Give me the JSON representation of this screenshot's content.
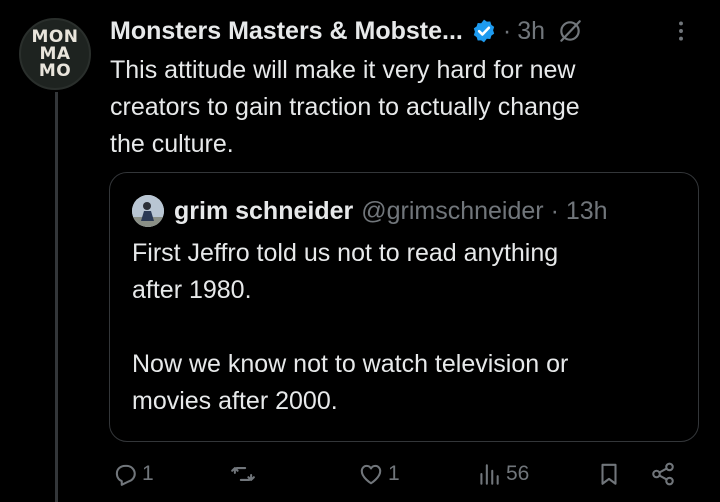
{
  "post": {
    "avatar_lines": [
      "MON",
      "MA",
      "MO"
    ],
    "author_name": "Monsters Masters & Mobste...",
    "separator": "·",
    "time": "3h",
    "text_lines": [
      "This attitude will make it very hard for new",
      "creators to gain traction to actually change",
      "the culture."
    ]
  },
  "quote": {
    "name": "grim schneider",
    "handle_time": "@grimschneider · 13h",
    "paragraphs": [
      [
        "First Jeffro told us not to read anything",
        "after 1980."
      ],
      [
        "Now we know not to watch television or",
        "movies after 2000."
      ]
    ]
  },
  "actions": {
    "reply_count": "1",
    "retweet_count": "",
    "like_count": "1",
    "views_count": "56"
  },
  "colors": {
    "background": "#000000",
    "text": "#e7e9ea",
    "muted": "#71767b",
    "verified": "#1d9bf0",
    "border": "#333639"
  },
  "icons": [
    "verified-badge-icon",
    "grok-icon",
    "more-icon",
    "reply-icon",
    "retweet-icon",
    "like-icon",
    "views-icon",
    "bookmark-icon",
    "share-icon"
  ]
}
